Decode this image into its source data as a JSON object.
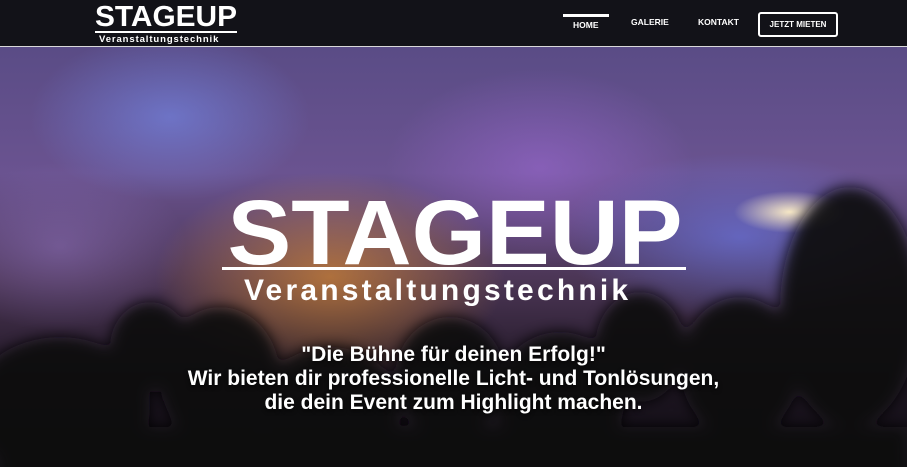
{
  "brand": {
    "wordmark": "STAGEUP",
    "subtitle": "Veranstaltungstechnik"
  },
  "nav": {
    "items": [
      {
        "label": "HOME",
        "active": true
      },
      {
        "label": "GALERIE",
        "active": false
      },
      {
        "label": "KONTAKT",
        "active": false
      }
    ],
    "cta_label": "JETZT MIETEN"
  },
  "hero": {
    "logo_wordmark": "STAGEUP",
    "logo_subtitle": "Veranstaltungstechnik",
    "tagline_lines": [
      "\"Die Bühne für deinen Erfolg!\"",
      "Wir bieten dir professionelle Licht- und Tonlösungen,",
      "die dein Event zum Highlight machen."
    ]
  },
  "colors": {
    "header_bg": "#121218",
    "text": "#ffffff"
  }
}
